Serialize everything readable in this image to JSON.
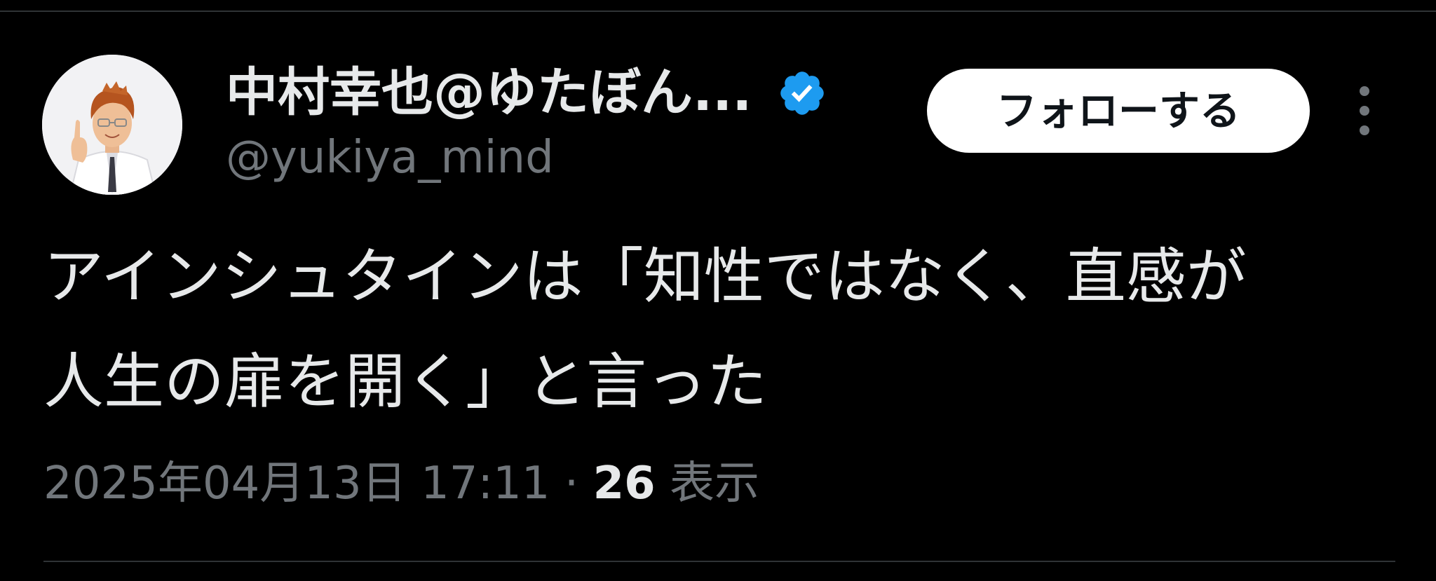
{
  "author": {
    "display_name": "中村幸也@ゆたぼん...",
    "handle": "@yukiya_mind",
    "verified": true
  },
  "actions": {
    "follow_label": "フォローする",
    "more_icon": "more-vertical-icon"
  },
  "tweet": {
    "text_line_1": "アインシュタインは「知性ではなく、直感が",
    "text_line_2": "人生の扉を開く」と言った"
  },
  "meta": {
    "timestamp": "2025年04月13日 17:11",
    "separator": "·",
    "views_count": "26",
    "views_label": "表示"
  },
  "colors": {
    "background": "#000000",
    "text_primary": "#e7e9ea",
    "text_secondary": "#71767b",
    "verified_blue": "#1d9bf0",
    "follow_button_bg": "#ffffff",
    "divider": "#2f3336"
  }
}
